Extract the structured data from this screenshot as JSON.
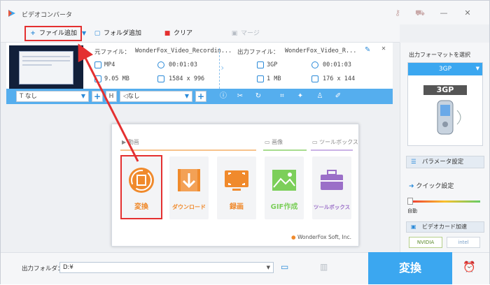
{
  "app": {
    "title": "ビデオコンバータ"
  },
  "toolbar": {
    "add_file": "ファイル追加",
    "add_folder": "フォルダ追加",
    "clear": "クリア",
    "merge": "マージ"
  },
  "source": {
    "label": "元ファイル：",
    "name": "WonderFox_Video_Recordin...",
    "format": "MP4",
    "duration": "00:01:03",
    "size": "9.05 MB",
    "resolution": "1584 x 996"
  },
  "output": {
    "label": "出力ファイル：",
    "name": "WonderFox_Video_R...",
    "format": "3GP",
    "duration": "00:01:03",
    "size": "1 MB",
    "resolution": "176 x 144"
  },
  "editbar": {
    "subtitle": "なし",
    "audio": "なし"
  },
  "popup": {
    "sections": {
      "video": "動画",
      "image": "画像",
      "toolbox": "ツールボックス"
    },
    "tiles": {
      "convert": "変換",
      "download": "ダウンロード",
      "record": "録画",
      "gif": "GIF作成",
      "toolbox": "ツールボックス"
    },
    "brand": "WonderFox Soft, Inc."
  },
  "right": {
    "format_title": "出力フォーマットを選択",
    "format": "3GP",
    "format_badge": "3GP",
    "param": "パラメータ設定",
    "quick": "クイック設定",
    "auto": "自動",
    "gpu": "ビデオカード加速",
    "nvidia": "NVIDIA",
    "intel": "intel"
  },
  "bottom": {
    "folder_label": "出力フォルダ：",
    "folder_value": "D:¥",
    "convert": "変換"
  },
  "colors": {
    "accent": "#3ba7f0",
    "orange": "#f08a2c",
    "green": "#7ccf5a",
    "purple": "#9b6fc8",
    "highlight": "#e43030"
  }
}
